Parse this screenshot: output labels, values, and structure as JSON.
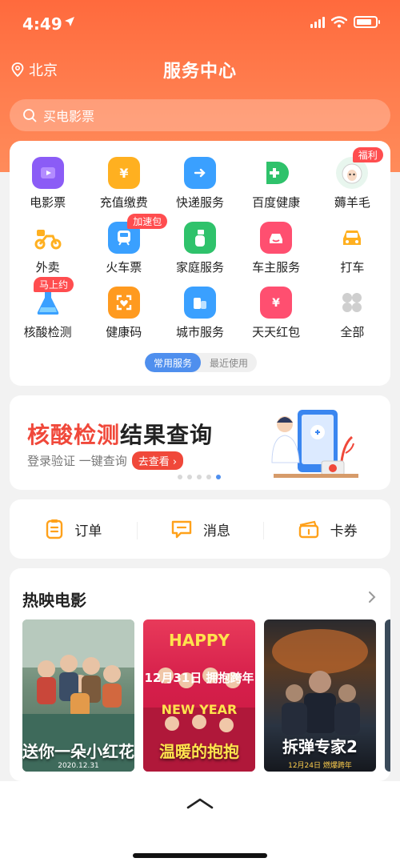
{
  "status": {
    "time": "4:49"
  },
  "nav": {
    "location": "北京",
    "title": "服务中心"
  },
  "search": {
    "placeholder": "买电影票"
  },
  "services": {
    "items": [
      {
        "label": "电影票",
        "icon": "movie-ticket-icon"
      },
      {
        "label": "充值缴费",
        "icon": "recharge-icon"
      },
      {
        "label": "快递服务",
        "icon": "express-icon"
      },
      {
        "label": "百度健康",
        "icon": "health-cross-icon"
      },
      {
        "label": "薅羊毛",
        "icon": "sheep-icon",
        "badge": "福利"
      },
      {
        "label": "外卖",
        "icon": "scooter-icon"
      },
      {
        "label": "火车票",
        "icon": "train-icon",
        "badge": "加速包"
      },
      {
        "label": "家庭服务",
        "icon": "spray-bottle-icon"
      },
      {
        "label": "车主服务",
        "icon": "car-owner-icon"
      },
      {
        "label": "打车",
        "icon": "taxi-icon"
      },
      {
        "label": "核酸检测",
        "icon": "test-tube-icon",
        "badge": "马上约"
      },
      {
        "label": "健康码",
        "icon": "health-code-icon"
      },
      {
        "label": "城市服务",
        "icon": "city-service-icon"
      },
      {
        "label": "天天红包",
        "icon": "red-packet-icon"
      },
      {
        "label": "全部",
        "icon": "grid-all-icon"
      }
    ],
    "tab_common": "常用服务",
    "tab_recent": "最近使用"
  },
  "banner": {
    "title_highlight": "核酸检测",
    "title_rest": "结果查询",
    "subtitle": "登录验证 一键查询",
    "button": "去查看",
    "page_count": 5,
    "active_page": 5
  },
  "quick_links": [
    {
      "label": "订单",
      "icon": "order-icon"
    },
    {
      "label": "消息",
      "icon": "message-icon"
    },
    {
      "label": "卡券",
      "icon": "coupon-icon"
    }
  ],
  "movies": {
    "title": "热映电影",
    "posters": [
      {
        "caption": "送你一朵小红花",
        "sub": "2020.12.31"
      },
      {
        "top": "HAPPY",
        "mid": "12月31日 拥抱跨年",
        "caption": "温暖的抱抱"
      },
      {
        "caption": "拆弹专家2",
        "sub": "12月24日 燃爆跨年"
      }
    ]
  },
  "colors": {
    "accent": "#ff6a3d",
    "highlight": "#f0483a",
    "blue": "#4f8fee"
  }
}
